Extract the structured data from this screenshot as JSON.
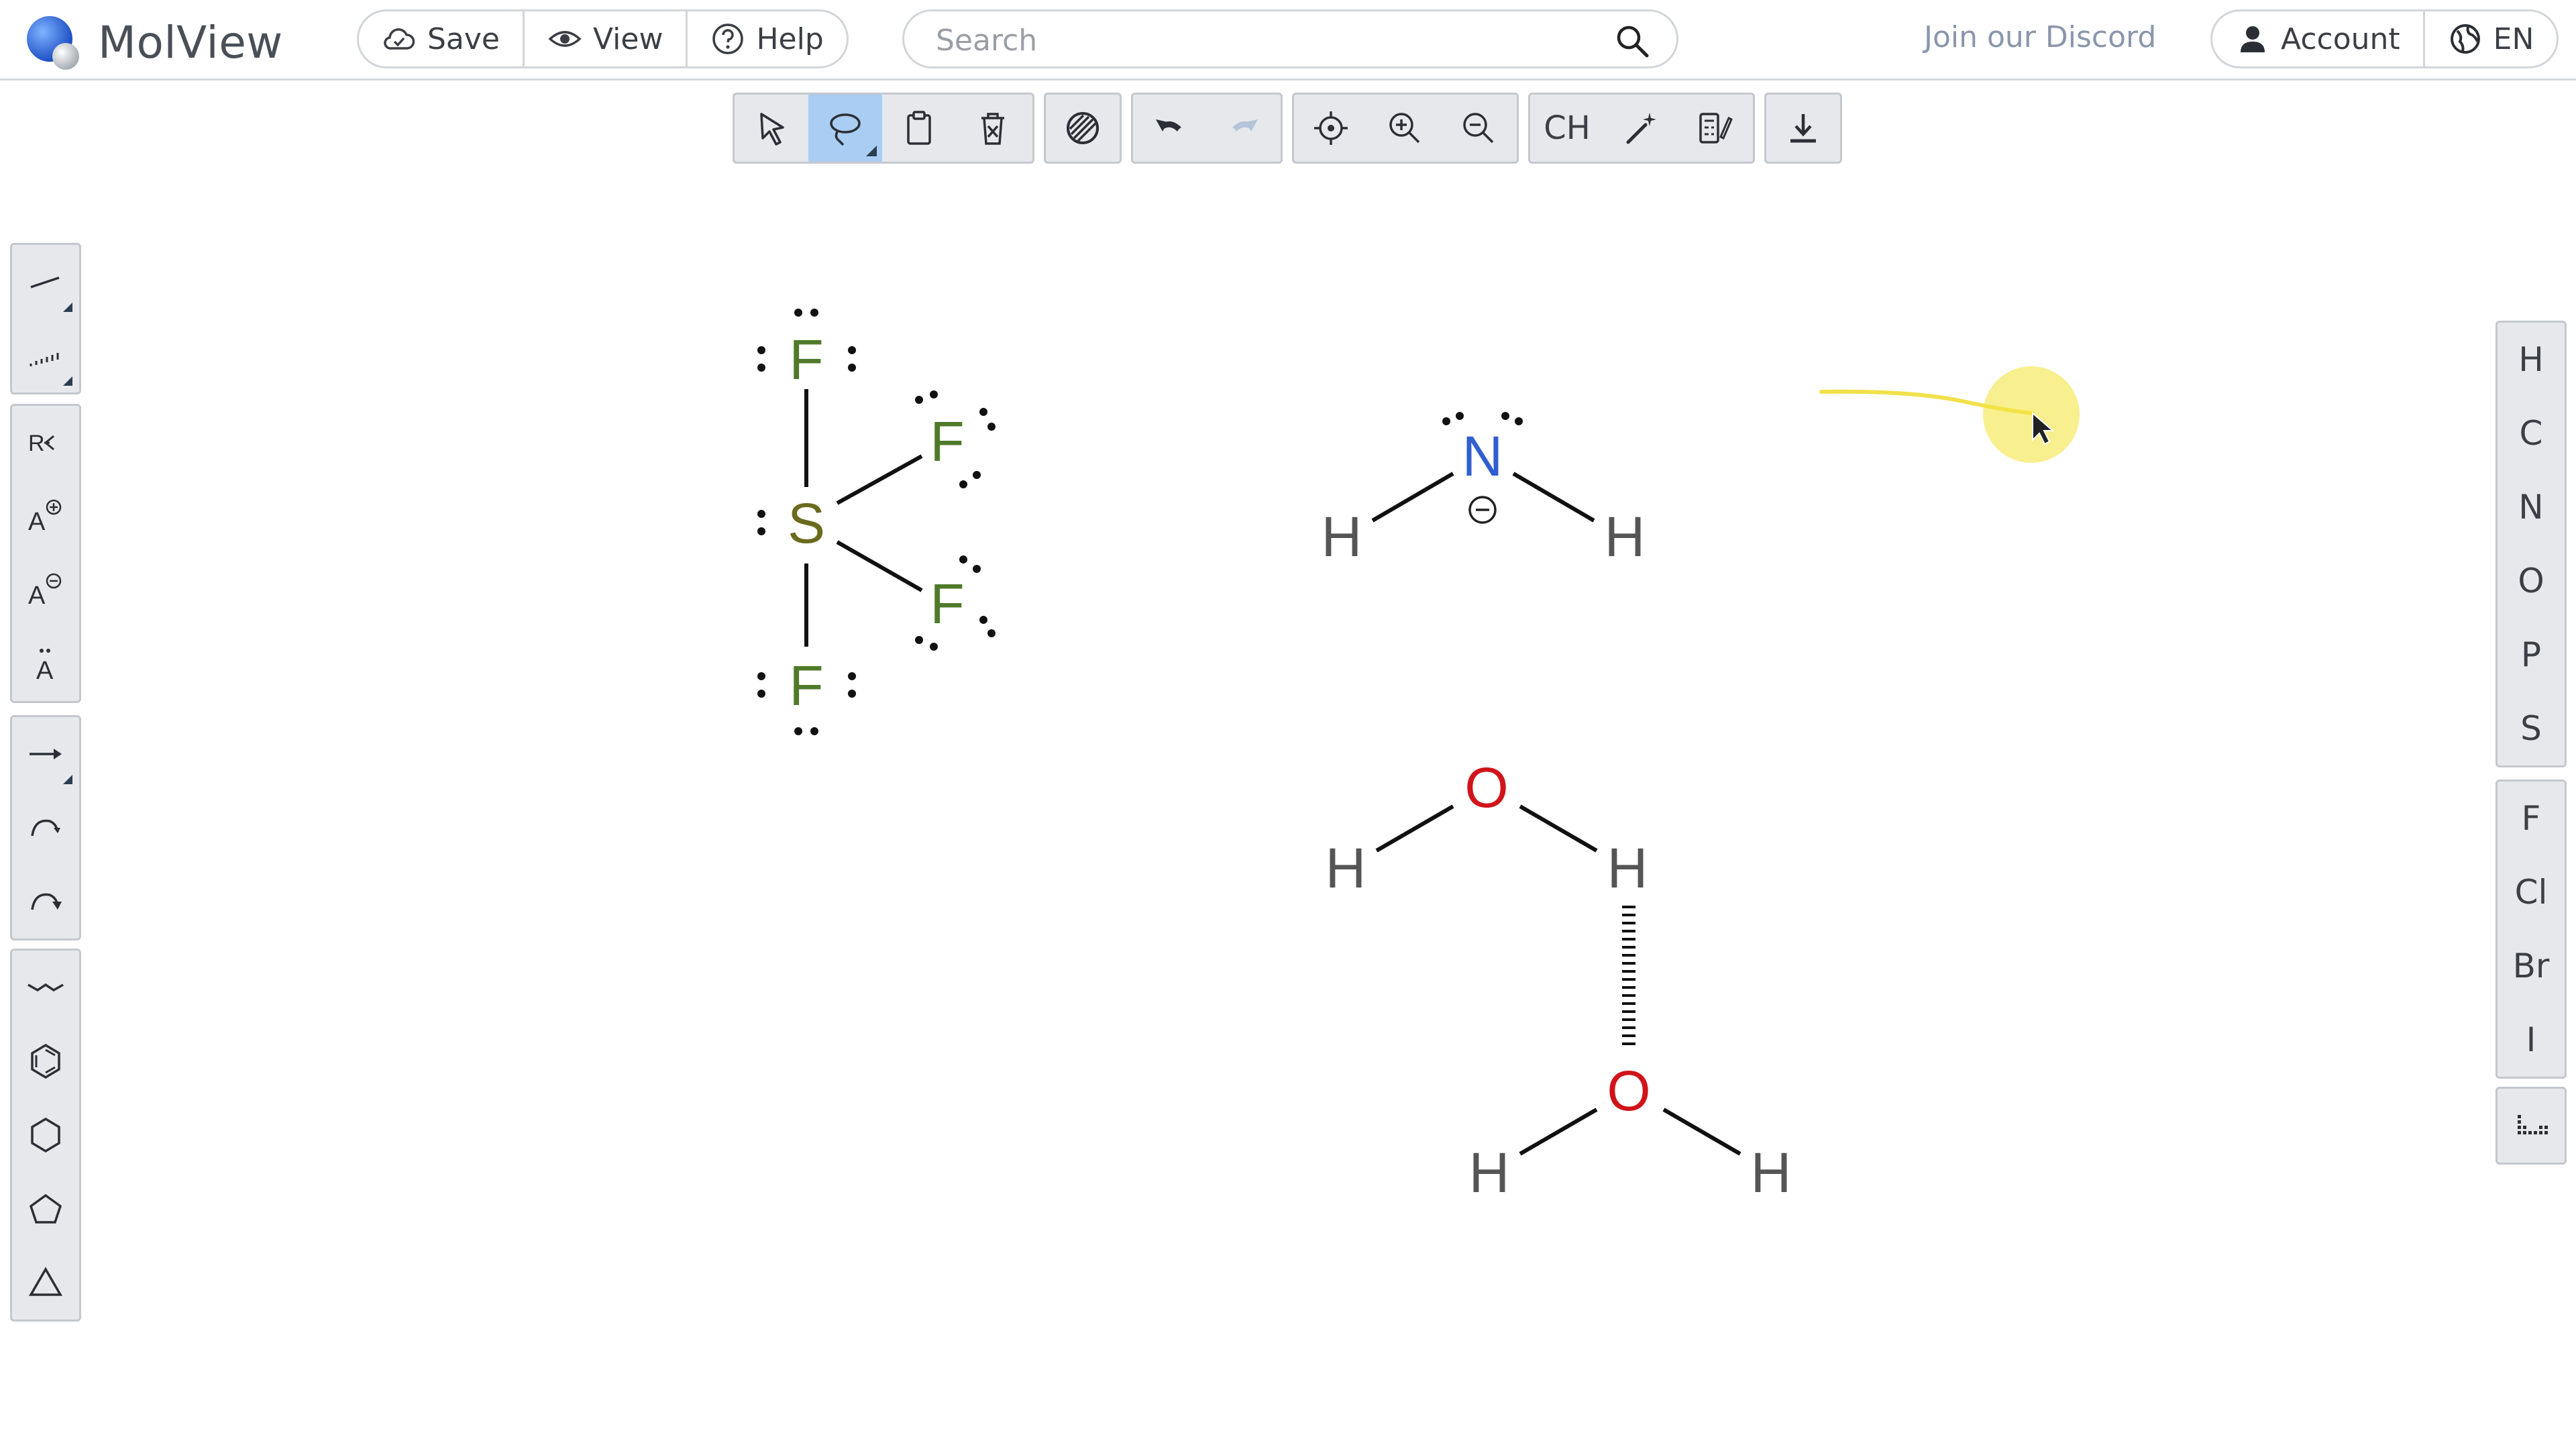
{
  "app": {
    "name": "MolView"
  },
  "header": {
    "buttons": [
      {
        "label": "Save",
        "icon": "cloud-check-icon"
      },
      {
        "label": "View",
        "icon": "eye-icon"
      },
      {
        "label": "Help",
        "icon": "help-circle-icon"
      }
    ],
    "search": {
      "placeholder": "Search",
      "value": ""
    },
    "discord_link": "Join our Discord",
    "account": {
      "label": "Account",
      "icon": "user-icon"
    },
    "language": {
      "label": "EN",
      "icon": "globe-icon"
    }
  },
  "top_toolbar": {
    "active_tool": "lasso-select",
    "text_button": "CH",
    "redo_enabled": false
  },
  "right_toolbar": {
    "elements_group_1": [
      "H",
      "C",
      "N",
      "O",
      "P",
      "S"
    ],
    "elements_group_2": [
      "F",
      "Cl",
      "Br",
      "I"
    ]
  },
  "canvas": {
    "colors": {
      "fluorine": "#4f7a2a",
      "sulfur": "#6b6b1e",
      "nitrogen": "#2f5fd0",
      "oxygen": "#d0141a",
      "hydrogen": "#555555",
      "bond": "#111111",
      "highlight": "#f4e542"
    },
    "sf4": {
      "central": "S",
      "ligands": [
        "F",
        "F",
        "F",
        "F"
      ]
    },
    "amide": {
      "central": "N",
      "charge": "−",
      "hydrogens": [
        "H",
        "H"
      ]
    },
    "water_1": {
      "central": "O",
      "hydrogens": [
        "H",
        "H"
      ]
    },
    "water_2": {
      "central": "O",
      "hydrogens": [
        "H",
        "H"
      ]
    }
  }
}
